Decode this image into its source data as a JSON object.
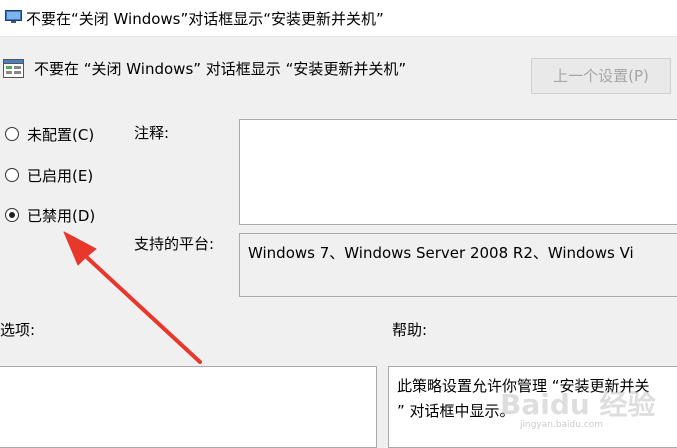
{
  "window": {
    "title": "不要在“关闭 Windows”对话框显示“安装更新并关机”"
  },
  "policy": {
    "name": "不要在 “关闭 Windows” 对话框显示 “安装更新并关机”",
    "prev_button": "上一个设置(P)"
  },
  "radios": [
    {
      "label": "未配置(C)",
      "checked": false
    },
    {
      "label": "已启用(E)",
      "checked": false
    },
    {
      "label": "已禁用(D)",
      "checked": true
    }
  ],
  "comment": {
    "label": "注释:",
    "value": ""
  },
  "platform": {
    "label": "支持的平台:",
    "value": "Windows 7、Windows Server 2008 R2、Windows Vi"
  },
  "options": {
    "label": "选项:"
  },
  "help": {
    "label": "帮助:",
    "lines": [
      "此策略设置允许你管理 “安装更新并关",
      "” 对话框中显示。"
    ]
  },
  "watermark": {
    "text": "Baidu 经验",
    "url": "jingyan.baidu.com"
  },
  "colors": {
    "arrow": "#e8372b",
    "disabled_text": "#a5a5a5",
    "background": "#f0f0f0"
  }
}
